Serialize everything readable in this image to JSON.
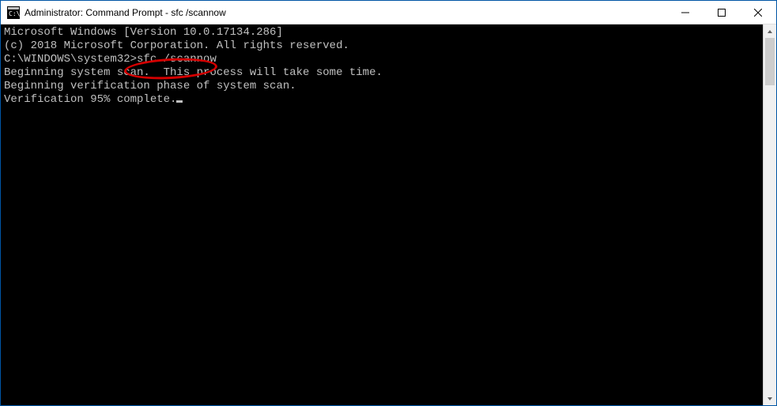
{
  "window": {
    "title": "Administrator: Command Prompt - sfc  /scannow"
  },
  "terminal": {
    "line1": "Microsoft Windows [Version 10.0.17134.286]",
    "line2": "(c) 2018 Microsoft Corporation. All rights reserved.",
    "line3": "",
    "prompt": "C:\\WINDOWS\\system32>",
    "command": "sfc /scannow",
    "line5": "",
    "line6": "Beginning system scan.  This process will take some time.",
    "line7": "",
    "line8": "Beginning verification phase of system scan.",
    "line9": "Verification 95% complete."
  },
  "annotation": {
    "target": "sfc /scannow",
    "style": "red-ellipse"
  }
}
